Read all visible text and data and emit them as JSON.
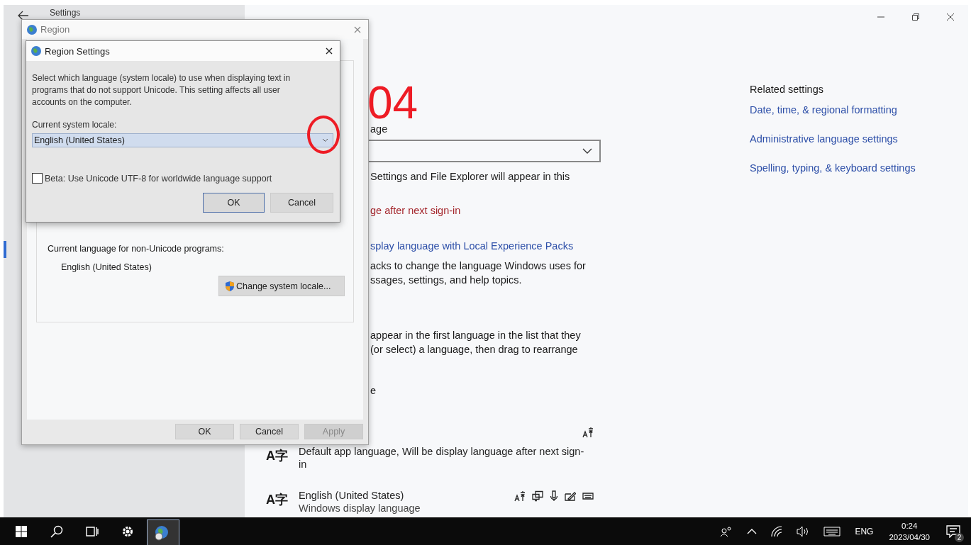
{
  "settings_window": {
    "title": "Settings",
    "main_fragments": [
      {
        "kind": "label",
        "lines": [
          "age"
        ]
      },
      {
        "kind": "dropdown"
      },
      {
        "kind": "text",
        "lines": [
          "Settings and File Explorer will appear in this"
        ]
      },
      {
        "kind": "warning",
        "lines": [
          "ge after next sign-in"
        ]
      },
      {
        "kind": "link",
        "lines": [
          "splay language with Local Experience Packs"
        ]
      },
      {
        "kind": "text",
        "lines": [
          "acks to change the language Windows uses for",
          "ssages, settings, and help topics."
        ]
      },
      {
        "kind": "text",
        "lines": [
          "appear in the first language in the list that they",
          "(or select) a language, then drag to rearrange"
        ]
      },
      {
        "kind": "text",
        "lines": [
          "e"
        ]
      }
    ],
    "languages": [
      {
        "icon_text": "A字",
        "description": "Default app language, Will be display language after next sign-in",
        "features": [
          {
            "kind": "language-pack"
          }
        ]
      },
      {
        "icon_text": "A字",
        "name": "English (United States)",
        "description": "Windows display language",
        "features": [
          {
            "kind": "language-pack"
          },
          {
            "kind": "display"
          },
          {
            "kind": "speech"
          },
          {
            "kind": "handwriting"
          },
          {
            "kind": "keyboard"
          }
        ]
      }
    ],
    "related_settings": {
      "title": "Related settings",
      "links": [
        "Date, time, & regional formatting",
        "Administrative language settings",
        "Spelling, typing, & keyboard settings"
      ]
    }
  },
  "region_dialog": {
    "title": "Region",
    "non_unicode_label": "Current language for non-Unicode programs:",
    "non_unicode_value": "English (United States)",
    "change_locale_button": "Change system locale...",
    "buttons": [
      {
        "label": "OK",
        "disabled": false
      },
      {
        "label": "Cancel",
        "disabled": false
      },
      {
        "label": "Apply",
        "disabled": true
      }
    ]
  },
  "region_settings_dialog": {
    "title": "Region Settings",
    "description": "Select which language (system locale) to use when displaying text in programs that do not support Unicode. This setting affects all user accounts on the computer.",
    "locale_label": "Current system locale:",
    "locale_value": "English (United States)",
    "utf8_checkbox": {
      "label": "Beta: Use Unicode UTF-8 for worldwide language support",
      "checked": false
    },
    "buttons": [
      {
        "label": "OK",
        "default": true
      },
      {
        "label": "Cancel",
        "default": false
      }
    ]
  },
  "annotation": {
    "label": "04"
  },
  "taskbar": {
    "apps": [
      {
        "kind": "search",
        "selected": false
      },
      {
        "kind": "task-view",
        "selected": false
      },
      {
        "kind": "settings",
        "selected": false
      },
      {
        "kind": "region",
        "selected": true
      }
    ],
    "language": "ENG",
    "time": "0:24",
    "date": "2023/04/30",
    "notifications": "2"
  }
}
